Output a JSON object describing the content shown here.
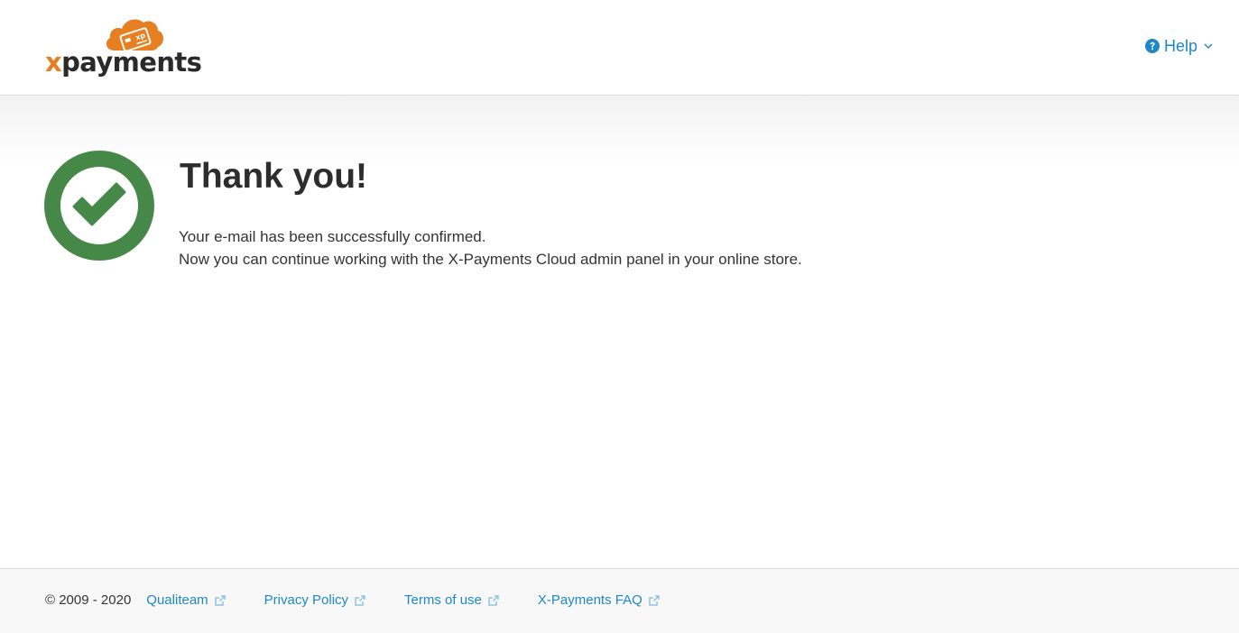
{
  "header": {
    "logo_text": "xpayments",
    "logo_text_x": "x",
    "logo_text_rest": "payments",
    "logo_badge": "xp",
    "help_label": "Help"
  },
  "main": {
    "title": "Thank you!",
    "message_line1": "Your e-mail has been successfully confirmed.",
    "message_line2": "Now you can continue working with the X-Payments Cloud admin panel in your online store."
  },
  "footer": {
    "copyright": "© 2009 - 2020",
    "links": [
      {
        "label": "Qualiteam",
        "icon": "external-link-icon"
      },
      {
        "label": "Privacy Policy",
        "icon": "external-link-icon"
      },
      {
        "label": "Terms of use",
        "icon": "external-link-icon"
      },
      {
        "label": "X-Payments FAQ",
        "icon": "external-link-icon"
      }
    ]
  },
  "colors": {
    "brand_orange": "#e67e22",
    "link_blue": "#1e87c8",
    "success_green": "#468847",
    "text_dark": "#333333"
  },
  "icons": {
    "help": "question-circle-icon",
    "help_dropdown": "chevron-down-icon",
    "success": "check-circle-icon"
  }
}
